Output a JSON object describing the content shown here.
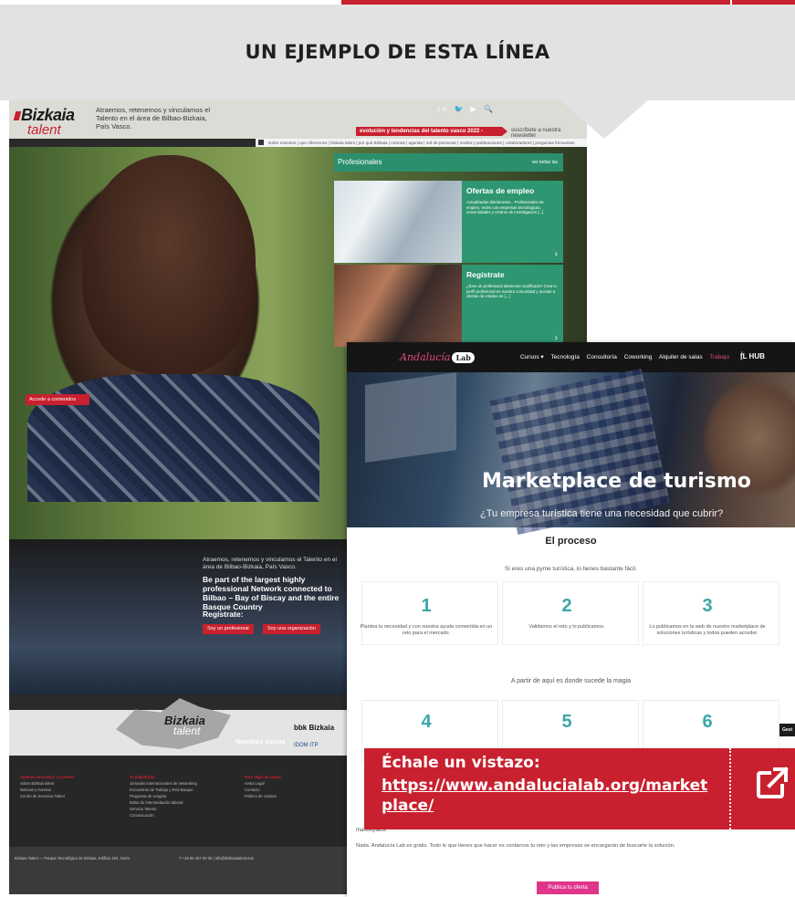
{
  "header": {
    "title": "UN EJEMPLO DE ESTA LÍNEA"
  },
  "bizkaia": {
    "logo_line1": "Bizkaia",
    "logo_line2": "talent",
    "tagline": "Atraemos, retenemos y vinculamos el Talento en el área de Bilbao-Bizkaia, País Vasco.",
    "social": "in  🐦  ▶  🔍",
    "report_banner": "evolución y tendencias del talento vasco 2022 - informe",
    "newsletter": "suscríbete a nuestra newsletter",
    "nav": "sobre nosotros | que ofrecemos | bizkaia talent | por qué Bizkaia | noticias | agenda | red de personas | revista y publicaciones | colaboradores | preguntas frecuentes",
    "hero_button": "Accede a contenidos",
    "panel_title": "Profesionales",
    "panel_link": "ver todas las",
    "cards": [
      {
        "title": "Ofertas de empleo",
        "desc": "Actualizadas diariamente... Profesionales de empleo, redes con empresas tecnológicas, universidades y centros de investigación [...]"
      },
      {
        "title": "Regístrate",
        "desc": "¿Eres un profesional altamente cualificado? Crea tu perfil profesional en nuestra comunidad y accede a ofertas de empleo en [...]"
      }
    ],
    "dark_text1": "Atraemos, retenemos y vinculamos el Talento en el área de Bilbao-Bizkaia, País Vasco.",
    "dark_text2": "Be part of the largest highly professional Network connected to Bilbao – Bay of Biscay and the entire Basque Country",
    "dark_register": "Regístrate:",
    "dark_btn1": "Soy un profesional",
    "dark_btn2": "Soy una organización",
    "partners_label": "Nuestros socios",
    "sponsor1": "bbk  Bizkaia",
    "sponsor2": "IDOM  ITP",
    "footer_cols": [
      {
        "heading": "Agentes asociados y partners",
        "items": [
          "Sobre Bizkaia talent",
          "Noticias y eventos",
          "Centro de Servicios Talent"
        ]
      },
      {
        "heading": "Tu plataforma",
        "items": [
          "Jornadas internacionales de networking",
          "Encuentros de Trabajo y Red Basque",
          "Programa de acogida",
          "Bolsa de intermediación laboral",
          "Servicio Talento",
          "Comunicación"
        ]
      },
      {
        "heading": "Para dejar de seguir",
        "items": [
          "Aviso Legal",
          "Contacto",
          "Política de cookies"
        ]
      }
    ],
    "footer_address": "Bizkaia Talent — Parque Tecnológico de Bizkaia, Edificio 204, Derio",
    "footer_contact": "T +34 94 407 00 00 | info@bizkaiatalent.eus"
  },
  "andalucia": {
    "logo": "Andalucía",
    "logo_badge": "Lab",
    "menu": [
      "Cursos ▾",
      "Tecnología",
      "Consultoría",
      "Coworking",
      "Alquiler de salas",
      "Trabajo",
      "ḟ̱L HUB"
    ],
    "menu_active_index": 5,
    "hero_title": "Marketplace de turismo",
    "hero_sub": "¿Tu empresa turística tiene una necesidad que cubrir?",
    "process_title": "El proceso",
    "process_intro": "Si eres una pyme turística, lo tienes bastante fácil.",
    "steps": [
      {
        "n": "1",
        "text": "Plantea tu necesidad y con nuestra ayuda convertida en un reto para el mercado."
      },
      {
        "n": "2",
        "text": "Validamos el reto y lo publicamos."
      },
      {
        "n": "3",
        "text": "Lo publicamos en la web de nuestro marketplace de soluciones turísticas y todos pueden acceder."
      },
      {
        "n": "4",
        "text": ""
      },
      {
        "n": "5",
        "text": ""
      },
      {
        "n": "6",
        "text": ""
      }
    ],
    "magic": "A partir de aquí es donde sucede la magia",
    "tail1": "marketplace.",
    "tail2": "Nada. Andalucía Lab es gratis. Todo lo que tienes que hacer es contarnos tu reto y las empresas se encargarán de buscarte la solución.",
    "cta": "Publica tu oferta",
    "cookie": "Gest"
  },
  "cta": {
    "label": "Échale un vistazo:",
    "link": "https://www.andalucialab.org/marketplace/",
    "icon": "external-link-icon",
    "color": "#c8202e"
  }
}
